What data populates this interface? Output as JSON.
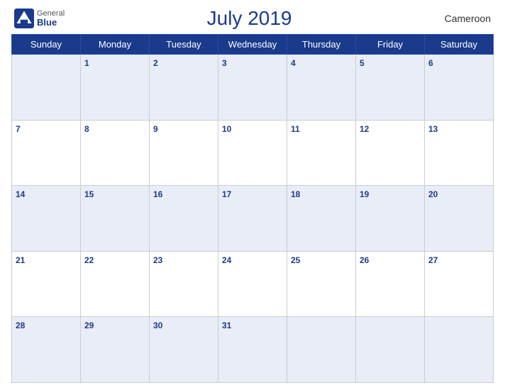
{
  "header": {
    "logo_general": "General",
    "logo_blue": "Blue",
    "title": "July 2019",
    "country": "Cameroon"
  },
  "calendar": {
    "days_of_week": [
      "Sunday",
      "Monday",
      "Tuesday",
      "Wednesday",
      "Thursday",
      "Friday",
      "Saturday"
    ],
    "weeks": [
      [
        null,
        1,
        2,
        3,
        4,
        5,
        6
      ],
      [
        7,
        8,
        9,
        10,
        11,
        12,
        13
      ],
      [
        14,
        15,
        16,
        17,
        18,
        19,
        20
      ],
      [
        21,
        22,
        23,
        24,
        25,
        26,
        27
      ],
      [
        28,
        29,
        30,
        31,
        null,
        null,
        null
      ]
    ]
  }
}
